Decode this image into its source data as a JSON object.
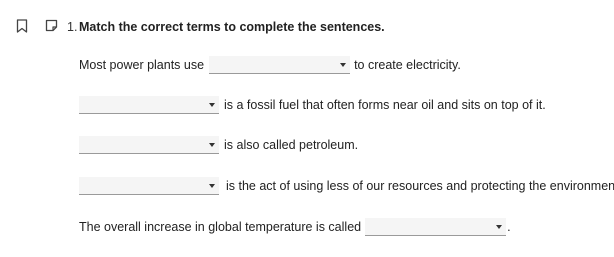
{
  "question": {
    "number": "1.",
    "title": "Match the correct terms to complete the sentences."
  },
  "icons": {
    "bookmark": "bookmark-icon",
    "note": "note-icon",
    "dropdown_caret": "caret-down-icon"
  },
  "sentences": [
    {
      "before": "Most power plants use",
      "after": "to create electricity.",
      "selected": ""
    },
    {
      "before": "",
      "after": "is a fossil fuel that often forms near oil and sits on top of it.",
      "selected": ""
    },
    {
      "before": "",
      "after": "is also called petroleum.",
      "selected": ""
    },
    {
      "before": "",
      "after": "is the act of using less of our resources and protecting the environment.",
      "selected": ""
    },
    {
      "before": "The overall increase in global temperature is called",
      "after": ".",
      "selected": ""
    }
  ]
}
